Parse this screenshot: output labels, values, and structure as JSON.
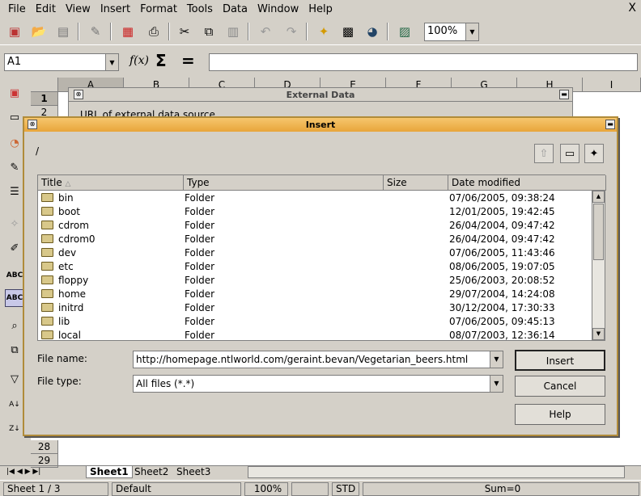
{
  "menu": {
    "items": [
      "File",
      "Edit",
      "View",
      "Insert",
      "Format",
      "Tools",
      "Data",
      "Window",
      "Help"
    ],
    "close_glyph": "X"
  },
  "toolbar": {
    "zoom": "100%"
  },
  "formula": {
    "name_box": "A1",
    "function_icon": "f(x)",
    "sum_icon": "Σ",
    "equals_icon": "="
  },
  "sheet": {
    "columns": [
      "A",
      "B",
      "C",
      "D",
      "E",
      "F",
      "G",
      "H",
      "I"
    ],
    "rows_top": [
      "1",
      "2"
    ],
    "rows_bottom": [
      "28",
      "29"
    ]
  },
  "external_data": {
    "title": "External Data",
    "url_label": "URL of external data source"
  },
  "dialog": {
    "title": "Insert",
    "path": "/",
    "columns": {
      "title": "Title",
      "type": "Type",
      "size": "Size",
      "date": "Date modified"
    },
    "files": [
      {
        "name": "bin",
        "type": "Folder",
        "date": "07/06/2005, 09:38:24"
      },
      {
        "name": "boot",
        "type": "Folder",
        "date": "12/01/2005, 19:42:45"
      },
      {
        "name": "cdrom",
        "type": "Folder",
        "date": "26/04/2004, 09:47:42"
      },
      {
        "name": "cdrom0",
        "type": "Folder",
        "date": "26/04/2004, 09:47:42"
      },
      {
        "name": "dev",
        "type": "Folder",
        "date": "07/06/2005, 11:43:46"
      },
      {
        "name": "etc",
        "type": "Folder",
        "date": "08/06/2005, 19:07:05"
      },
      {
        "name": "floppy",
        "type": "Folder",
        "date": "25/06/2003, 20:08:52"
      },
      {
        "name": "home",
        "type": "Folder",
        "date": "29/07/2004, 14:24:08"
      },
      {
        "name": "initrd",
        "type": "Folder",
        "date": "30/12/2004, 17:30:33"
      },
      {
        "name": "lib",
        "type": "Folder",
        "date": "07/06/2005, 09:45:13"
      },
      {
        "name": "local",
        "type": "Folder",
        "date": "08/07/2003, 12:36:14"
      }
    ],
    "file_name_label": "File name:",
    "file_name_value": "http://homepage.ntlworld.com/geraint.bevan/Vegetarian_beers.html",
    "file_type_label": "File type:",
    "file_type_value": "All files (*.*)",
    "insert_button": "Insert",
    "cancel_button": "Cancel",
    "help_button": "Help"
  },
  "tabs": [
    "Sheet1",
    "Sheet2",
    "Sheet3"
  ],
  "status": {
    "sheet": "Sheet 1 / 3",
    "style": "Default",
    "zoom": "100%",
    "mode": "STD",
    "sum": "Sum=0"
  }
}
